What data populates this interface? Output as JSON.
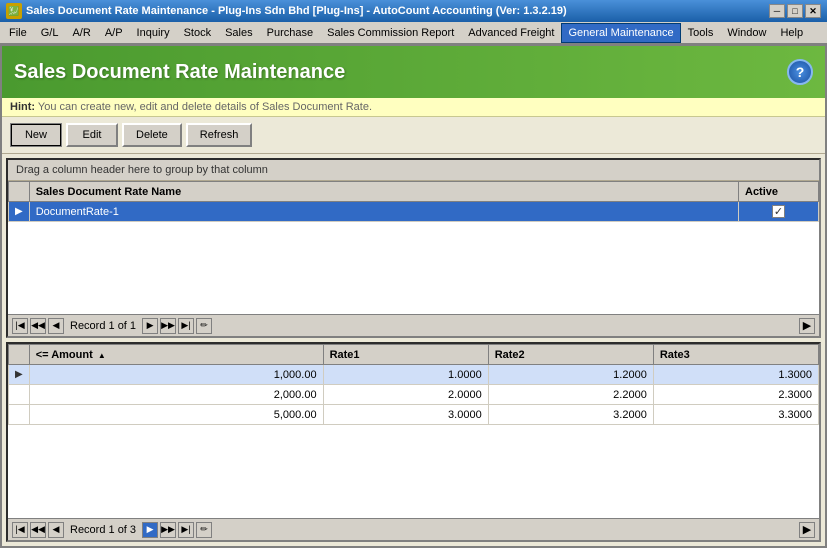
{
  "titleBar": {
    "icon": "SD",
    "text": "Sales Document Rate Maintenance - Plug-Ins Sdn Bhd [Plug-Ins] - AutoCount Accounting (Ver: 1.3.2.19)",
    "minimize": "─",
    "restore": "□",
    "close": "✕"
  },
  "menuBar": {
    "items": [
      {
        "id": "file",
        "label": "File"
      },
      {
        "id": "gl",
        "label": "G/L"
      },
      {
        "id": "ar",
        "label": "A/R"
      },
      {
        "id": "ap",
        "label": "A/P"
      },
      {
        "id": "inquiry",
        "label": "Inquiry"
      },
      {
        "id": "stock",
        "label": "Stock"
      },
      {
        "id": "sales",
        "label": "Sales"
      },
      {
        "id": "purchase",
        "label": "Purchase"
      },
      {
        "id": "salescomm",
        "label": "Sales Commission Report"
      },
      {
        "id": "advfreight",
        "label": "Advanced Freight"
      },
      {
        "id": "genmaint",
        "label": "General Maintenance",
        "active": true
      },
      {
        "id": "tools",
        "label": "Tools"
      },
      {
        "id": "window",
        "label": "Window"
      },
      {
        "id": "help",
        "label": "Help"
      }
    ]
  },
  "pageHeader": {
    "title": "Sales Document Rate Maintenance",
    "helpIcon": "?"
  },
  "hint": {
    "label": "Hint:",
    "text": " You can create new, edit and delete details of Sales Document Rate."
  },
  "toolbar": {
    "newLabel": "New",
    "editLabel": "Edit",
    "deleteLabel": "Delete",
    "refreshLabel": "Refresh"
  },
  "topGrid": {
    "groupHeader": "Drag a column header here to group by that column",
    "columns": [
      {
        "id": "name",
        "label": "Sales Document Rate Name"
      },
      {
        "id": "active",
        "label": "Active"
      }
    ],
    "rows": [
      {
        "id": 1,
        "name": "DocumentRate-1",
        "active": true,
        "selected": true
      }
    ],
    "nav": {
      "recordText": "Record 1 of 1"
    }
  },
  "bottomGrid": {
    "columns": [
      {
        "id": "amount",
        "label": "<= Amount",
        "sortable": true
      },
      {
        "id": "rate1",
        "label": "Rate1"
      },
      {
        "id": "rate2",
        "label": "Rate2"
      },
      {
        "id": "rate3",
        "label": "Rate3"
      }
    ],
    "rows": [
      {
        "id": 1,
        "amount": "1,000.00",
        "rate1": "1.0000",
        "rate2": "1.2000",
        "rate3": "1.3000",
        "selected": true
      },
      {
        "id": 2,
        "amount": "2,000.00",
        "rate1": "2.0000",
        "rate2": "2.2000",
        "rate3": "2.3000",
        "selected": false
      },
      {
        "id": 3,
        "amount": "5,000.00",
        "rate1": "3.0000",
        "rate2": "3.2000",
        "rate3": "3.3000",
        "selected": false
      }
    ],
    "nav": {
      "recordText": "Record 1 of 3"
    }
  }
}
